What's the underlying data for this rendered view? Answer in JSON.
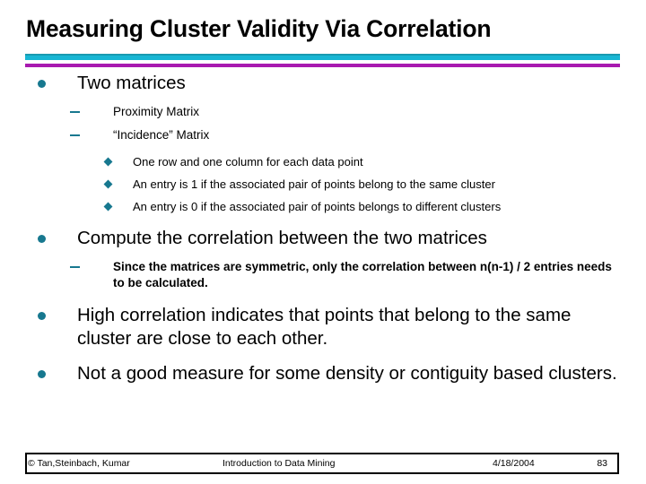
{
  "slide": {
    "title": "Measuring Cluster Validity Via Correlation",
    "theme": {
      "rule_teal_thin": "#1a9ab0",
      "rule_cyan": "#17b6d4",
      "rule_magenta": "#a81ab0",
      "bullet_color": "#17788f",
      "text_color": "#000000",
      "background": "#ffffff"
    }
  },
  "content": {
    "block1": {
      "heading": "Two matrices",
      "sub": [
        "Proximity Matrix",
        "“Incidence” Matrix"
      ],
      "subsub": [
        "One row and one column for each data point",
        "An entry is 1 if the associated pair of points belong to the same cluster",
        "An entry is 0 if the associated pair of points belongs to different clusters"
      ]
    },
    "block2": {
      "heading": "Compute the correlation between the two matrices",
      "sub": [
        "Since the matrices are symmetric, only the correlation between n(n-1) / 2 entries needs to be calculated."
      ]
    },
    "block3": {
      "heading": "High correlation indicates that points that belong to the same cluster are close to each other."
    },
    "block4": {
      "heading": "Not a good measure for some density or contiguity based clusters."
    }
  },
  "footer": {
    "author": "© Tan,Steinbach, Kumar",
    "center": "Introduction to Data Mining",
    "date": "4/18/2004",
    "page": "83"
  }
}
